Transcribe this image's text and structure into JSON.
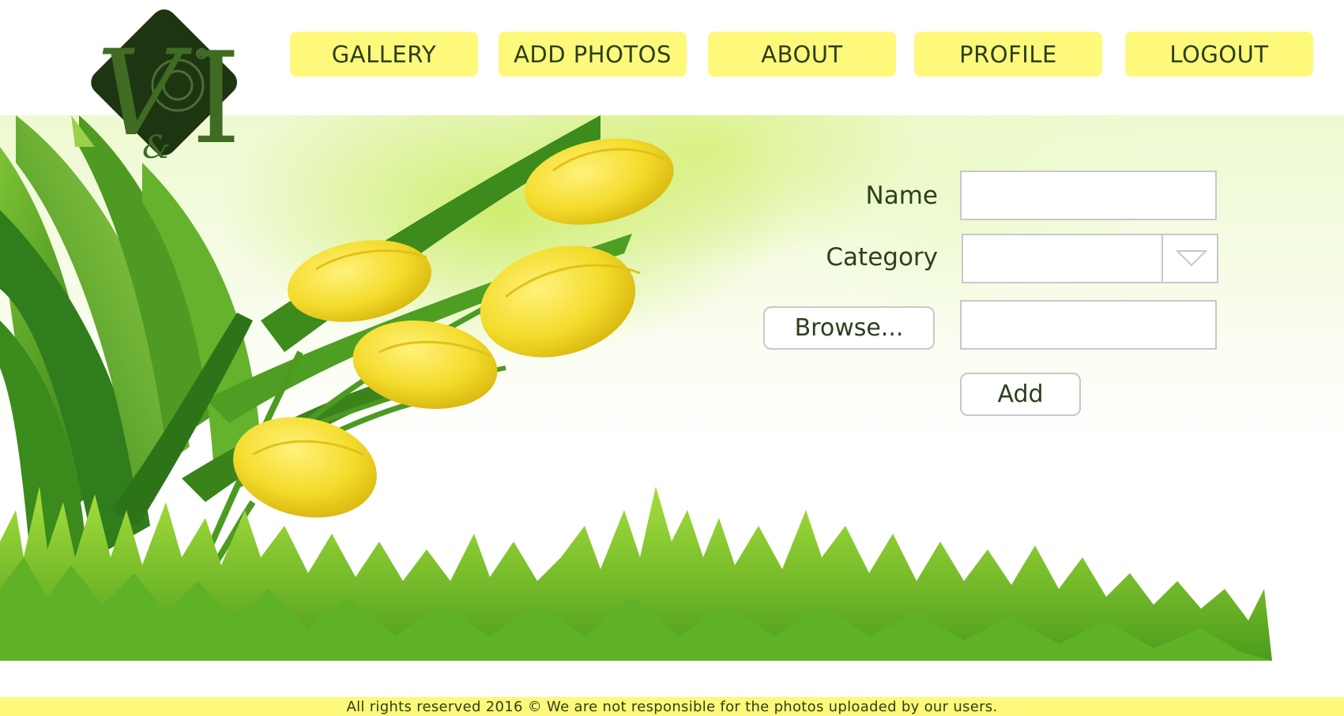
{
  "nav": {
    "gallery": "GALLERY",
    "add_photos": "ADD PHOTOS",
    "about": "ABOUT",
    "profile": "PROFILE",
    "logout": "LOGOUT"
  },
  "logo": {
    "icon": "camera-monogram-logo"
  },
  "form": {
    "name_label": "Name",
    "name_value": "",
    "category_label": "Category",
    "category_selected": "",
    "browse_label": "Browse...",
    "file_value": "",
    "add_label": "Add"
  },
  "footer": {
    "text": "All rights reserved 2016 ©  We are not responsible for the photos uploaded by our users."
  },
  "colors": {
    "accent": "#fef97a",
    "text": "#2d3f1c",
    "logo_dark": "#1e3512",
    "logo_green": "#3f6b22"
  }
}
